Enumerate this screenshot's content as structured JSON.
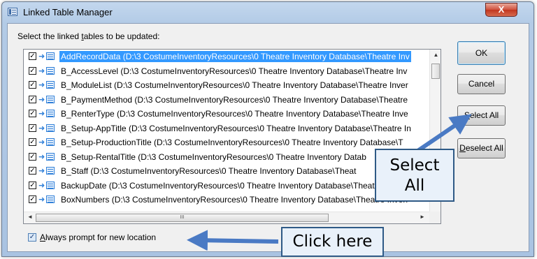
{
  "window": {
    "title": "Linked Table Manager",
    "close_glyph": "X"
  },
  "instruction": {
    "prefix": "Select the linked ",
    "mnemonic": "t",
    "suffix": "ables to be updated:"
  },
  "list": {
    "items": [
      {
        "label": "AddRecordData  (D:\\3 CostumeInventoryResources\\0 Theatre Inventory Database\\Theatre Inv",
        "checked": true,
        "selected": true
      },
      {
        "label": "B_AccessLevel  (D:\\3 CostumeInventoryResources\\0 Theatre Inventory Database\\Theatre Inv",
        "checked": true,
        "selected": false
      },
      {
        "label": "B_ModuleList  (D:\\3 CostumeInventoryResources\\0 Theatre Inventory Database\\Theatre Inver",
        "checked": true,
        "selected": false
      },
      {
        "label": "B_PaymentMethod  (D:\\3 CostumeInventoryResources\\0 Theatre Inventory Database\\Theatre",
        "checked": true,
        "selected": false
      },
      {
        "label": "B_RenterType  (D:\\3 CostumeInventoryResources\\0 Theatre Inventory Database\\Theatre Inve",
        "checked": true,
        "selected": false
      },
      {
        "label": "B_Setup-AppTitle  (D:\\3 CostumeInventoryResources\\0 Theatre Inventory Database\\Theatre In",
        "checked": true,
        "selected": false
      },
      {
        "label": "B_Setup-ProductionTitle  (D:\\3 CostumeInventoryResources\\0 Theatre Inventory Database\\T",
        "checked": true,
        "selected": false
      },
      {
        "label": "B_Setup-RentalTitle  (D:\\3 CostumeInventoryResources\\0 Theatre Inventory Datab",
        "checked": true,
        "selected": false
      },
      {
        "label": "B_Staff  (D:\\3 CostumeInventoryResources\\0 Theatre Inventory Database\\Theat",
        "checked": true,
        "selected": false
      },
      {
        "label": "BackupDate  (D:\\3 CostumeInventoryResources\\0 Theatre Inventory Database\\Theatre",
        "checked": true,
        "selected": false
      },
      {
        "label": "BoxNumbers  (D:\\3 CostumeInventoryResources\\0 Theatre Inventory Database\\Theatre Inven",
        "checked": true,
        "selected": false
      }
    ],
    "check_glyph": "✓",
    "hscroll_grip": "III",
    "arrow_up": "▲",
    "arrow_left": "◄",
    "arrow_right": "►"
  },
  "buttons": {
    "ok": "OK",
    "cancel": "Cancel",
    "select_all_mnemonic": "S",
    "select_all_rest": "elect All",
    "deselect_all_mnemonic": "D",
    "deselect_all_rest": "eselect All"
  },
  "prompt": {
    "checked": true,
    "mnemonic": "A",
    "rest": "lways prompt for new location"
  },
  "callouts": {
    "select_all_line1": "Select",
    "select_all_line2": "All",
    "click_here": "Click here"
  },
  "colors": {
    "selection": "#3399ff",
    "callout_fill": "#e9f1fa",
    "callout_border": "#2f5a86",
    "arrow": "#4a7ac4"
  }
}
